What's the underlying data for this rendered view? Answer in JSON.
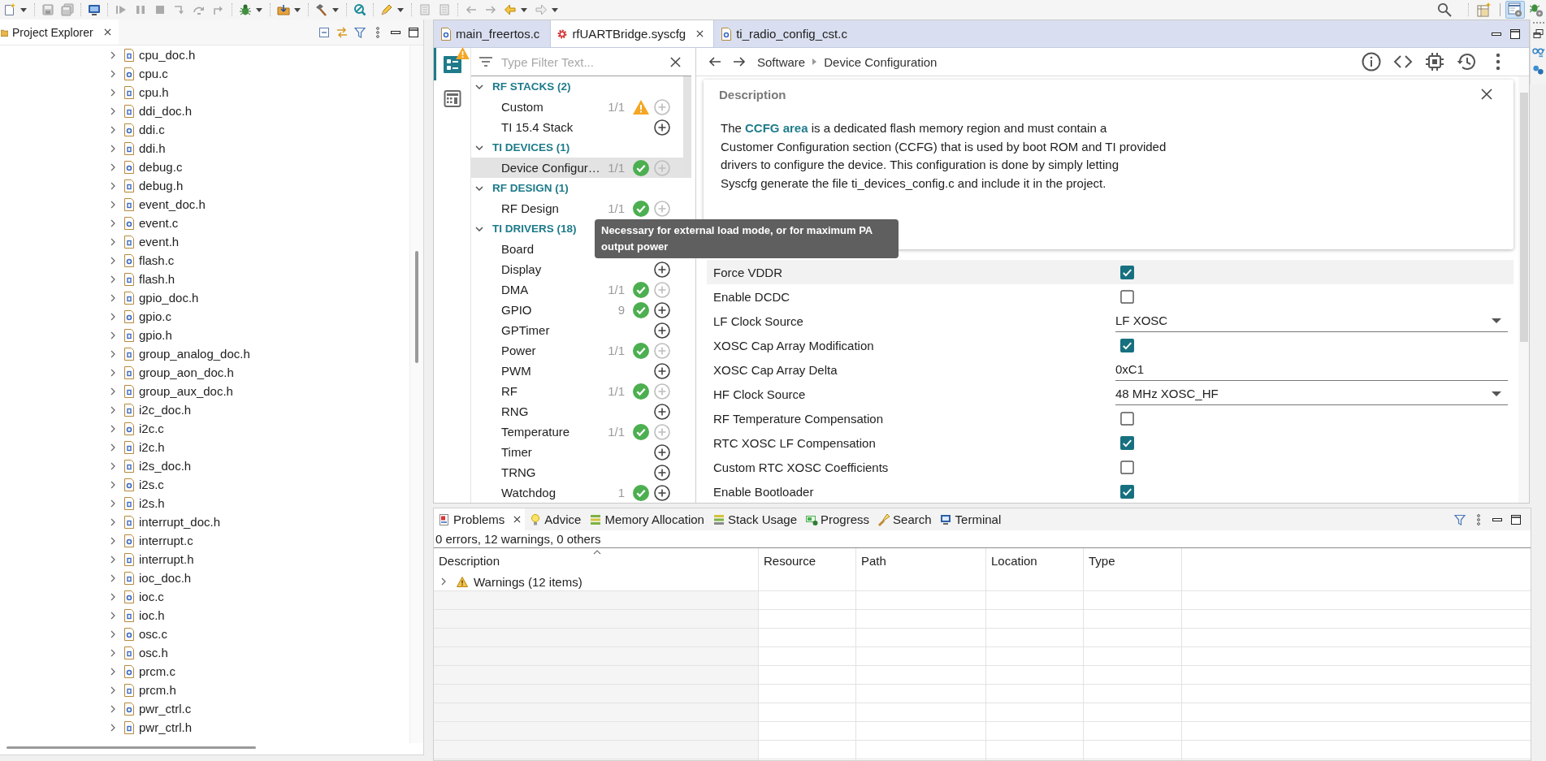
{
  "toolbar": {
    "perspectives": [
      {
        "kind": "syscfg",
        "selected": true
      },
      {
        "kind": "debug",
        "selected": false
      }
    ]
  },
  "project_explorer": {
    "title": "Project Explorer",
    "files": [
      {
        "name": "cpu_doc.h",
        "kind": "header",
        "expanded": false
      },
      {
        "name": "cpu.c",
        "kind": "source",
        "expanded": false
      },
      {
        "name": "cpu.h",
        "kind": "header",
        "expanded": false
      },
      {
        "name": "ddi_doc.h",
        "kind": "header",
        "expanded": false
      },
      {
        "name": "ddi.c",
        "kind": "source",
        "expanded": false
      },
      {
        "name": "ddi.h",
        "kind": "header",
        "expanded": false
      },
      {
        "name": "debug.c",
        "kind": "source",
        "expanded": false
      },
      {
        "name": "debug.h",
        "kind": "header",
        "expanded": false
      },
      {
        "name": "event_doc.h",
        "kind": "header",
        "expanded": false
      },
      {
        "name": "event.c",
        "kind": "source",
        "expanded": false
      },
      {
        "name": "event.h",
        "kind": "header",
        "expanded": false
      },
      {
        "name": "flash.c",
        "kind": "source",
        "expanded": false
      },
      {
        "name": "flash.h",
        "kind": "header",
        "expanded": false
      },
      {
        "name": "gpio_doc.h",
        "kind": "header",
        "expanded": false
      },
      {
        "name": "gpio.c",
        "kind": "source",
        "expanded": false
      },
      {
        "name": "gpio.h",
        "kind": "header",
        "expanded": false
      },
      {
        "name": "group_analog_doc.h",
        "kind": "header",
        "expanded": false
      },
      {
        "name": "group_aon_doc.h",
        "kind": "header",
        "expanded": false
      },
      {
        "name": "group_aux_doc.h",
        "kind": "header",
        "expanded": false
      },
      {
        "name": "i2c_doc.h",
        "kind": "header",
        "expanded": false
      },
      {
        "name": "i2c.c",
        "kind": "source",
        "expanded": false
      },
      {
        "name": "i2c.h",
        "kind": "header",
        "expanded": false
      },
      {
        "name": "i2s_doc.h",
        "kind": "header",
        "expanded": false
      },
      {
        "name": "i2s.c",
        "kind": "source",
        "expanded": false
      },
      {
        "name": "i2s.h",
        "kind": "header",
        "expanded": false
      },
      {
        "name": "interrupt_doc.h",
        "kind": "header",
        "expanded": false
      },
      {
        "name": "interrupt.c",
        "kind": "source",
        "expanded": false
      },
      {
        "name": "interrupt.h",
        "kind": "header",
        "expanded": false
      },
      {
        "name": "ioc_doc.h",
        "kind": "header",
        "expanded": false
      },
      {
        "name": "ioc.c",
        "kind": "source",
        "expanded": false
      },
      {
        "name": "ioc.h",
        "kind": "header",
        "expanded": false
      },
      {
        "name": "osc.c",
        "kind": "source",
        "expanded": false
      },
      {
        "name": "osc.h",
        "kind": "header",
        "expanded": false
      },
      {
        "name": "prcm.c",
        "kind": "source",
        "expanded": false
      },
      {
        "name": "prcm.h",
        "kind": "header",
        "expanded": false
      },
      {
        "name": "pwr_ctrl.c",
        "kind": "source",
        "expanded": false
      },
      {
        "name": "pwr_ctrl.h",
        "kind": "header",
        "expanded": false
      }
    ]
  },
  "editor": {
    "tabs": [
      {
        "label": "main_freertos.c",
        "kind": "source",
        "selected": false
      },
      {
        "label": "rfUARTBridge.syscfg",
        "kind": "syscfg",
        "selected": true
      },
      {
        "label": "ti_radio_config_cst.c",
        "kind": "source",
        "selected": false
      }
    ]
  },
  "syscfg": {
    "views": [
      {
        "kind": "config",
        "selected": true,
        "warning": true
      },
      {
        "kind": "calculator",
        "selected": false,
        "warning": false
      }
    ],
    "filter": {
      "placeholder": "Type Filter Text..."
    },
    "categories": [
      {
        "name": "RF STACKS (2)",
        "expanded": true,
        "modules": [
          {
            "name": "Custom",
            "count": "1/1",
            "check": false,
            "warning": true,
            "add_enabled": false,
            "selected": false
          },
          {
            "name": "TI 15.4 Stack",
            "check": false,
            "warning": false,
            "add_enabled": true,
            "selected": false
          }
        ]
      },
      {
        "name": "TI DEVICES (1)",
        "expanded": true,
        "modules": [
          {
            "name": "Device Configur…",
            "count": "1/1",
            "check": true,
            "warning": false,
            "add_enabled": false,
            "selected": true
          }
        ]
      },
      {
        "name": "RF DESIGN (1)",
        "expanded": true,
        "modules": [
          {
            "name": "RF Design",
            "count": "1/1",
            "check": true,
            "warning": false,
            "add_enabled": false,
            "selected": false
          }
        ]
      },
      {
        "name": "TI DRIVERS (18)",
        "expanded": true,
        "modules": [
          {
            "name": "Board",
            "selected": false
          },
          {
            "name": "Display",
            "check": false,
            "warning": false,
            "add_enabled": true,
            "selected": false
          },
          {
            "name": "DMA",
            "count": "1/1",
            "check": true,
            "warning": false,
            "add_enabled": false,
            "selected": false
          },
          {
            "name": "GPIO",
            "count": "9",
            "check": true,
            "warning": false,
            "add_enabled": true,
            "selected": false
          },
          {
            "name": "GPTimer",
            "check": false,
            "warning": false,
            "add_enabled": true,
            "selected": false
          },
          {
            "name": "Power",
            "count": "1/1",
            "check": true,
            "warning": false,
            "add_enabled": false,
            "selected": false
          },
          {
            "name": "PWM",
            "check": false,
            "warning": false,
            "add_enabled": true,
            "selected": false
          },
          {
            "name": "RF",
            "count": "1/1",
            "check": true,
            "warning": false,
            "add_enabled": false,
            "selected": false
          },
          {
            "name": "RNG",
            "check": false,
            "warning": false,
            "add_enabled": true,
            "selected": false
          },
          {
            "name": "Temperature",
            "count": "1/1",
            "check": true,
            "warning": false,
            "add_enabled": false,
            "selected": false
          },
          {
            "name": "Timer",
            "check": false,
            "warning": false,
            "add_enabled": true,
            "selected": false
          },
          {
            "name": "TRNG",
            "check": false,
            "warning": false,
            "add_enabled": true,
            "selected": false
          },
          {
            "name": "Watchdog",
            "count": "1",
            "check": true,
            "warning": false,
            "add_enabled": true,
            "selected": false
          }
        ]
      }
    ],
    "breadcrumb": [
      "Software",
      "Device Configuration"
    ],
    "description": {
      "title": "Description",
      "text": "The **CCFG area** is a dedicated flash memory region and must contain a\nCustomer Configuration section (CCFG) that is used by boot ROM and TI provided\ndrivers to configure the device. This configuration is done by simply letting\nSyscfg generate the file ti_devices_config.c and include it in the project."
    },
    "settings": [
      {
        "label": "Force VDDR",
        "kind": "checkbox",
        "checked": true,
        "hovered": true
      },
      {
        "label": "Enable DCDC",
        "kind": "checkbox",
        "checked": false,
        "hovered": false
      },
      {
        "label": "LF Clock Source",
        "kind": "dropdown",
        "value": "LF XOSC",
        "hovered": false
      },
      {
        "label": "XOSC Cap Array Modification",
        "kind": "checkbox",
        "checked": true,
        "hovered": false
      },
      {
        "label": "XOSC Cap Array Delta",
        "kind": "text",
        "value": "0xC1",
        "hovered": false
      },
      {
        "label": "HF Clock Source",
        "kind": "dropdown",
        "value": "48 MHz XOSC_HF",
        "hovered": false
      },
      {
        "label": "RF Temperature Compensation",
        "kind": "checkbox",
        "checked": false,
        "hovered": false
      },
      {
        "label": "RTC XOSC LF Compensation",
        "kind": "checkbox",
        "checked": true,
        "hovered": false
      },
      {
        "label": "Custom RTC XOSC Coefficients",
        "kind": "checkbox",
        "checked": false,
        "hovered": false
      },
      {
        "label": "Enable Bootloader",
        "kind": "checkbox",
        "checked": true,
        "hovered": false
      }
    ],
    "tooltip": "Necessary for external load mode, or for maximum PA output power"
  },
  "problems": {
    "tabs": [
      {
        "label": "Problems",
        "kind": "problems",
        "selected": true
      },
      {
        "label": "Advice",
        "kind": "advice",
        "selected": false
      },
      {
        "label": "Memory Allocation",
        "kind": "memory",
        "selected": false
      },
      {
        "label": "Stack Usage",
        "kind": "stack",
        "selected": false
      },
      {
        "label": "Progress",
        "kind": "progress",
        "selected": false
      },
      {
        "label": "Search",
        "kind": "search",
        "selected": false
      },
      {
        "label": "Terminal",
        "kind": "terminal",
        "selected": false
      }
    ],
    "summary": "0 errors, 12 warnings, 0 others",
    "columns": [
      {
        "label": "Description",
        "sorted": true
      },
      {
        "label": "Resource",
        "sorted": false
      },
      {
        "label": "Path",
        "sorted": false
      },
      {
        "label": "Location",
        "sorted": false
      },
      {
        "label": "Type",
        "sorted": false
      }
    ],
    "rows": [
      {
        "description": "Warnings (12 items)",
        "kind": "warning",
        "expanded": false
      }
    ]
  }
}
